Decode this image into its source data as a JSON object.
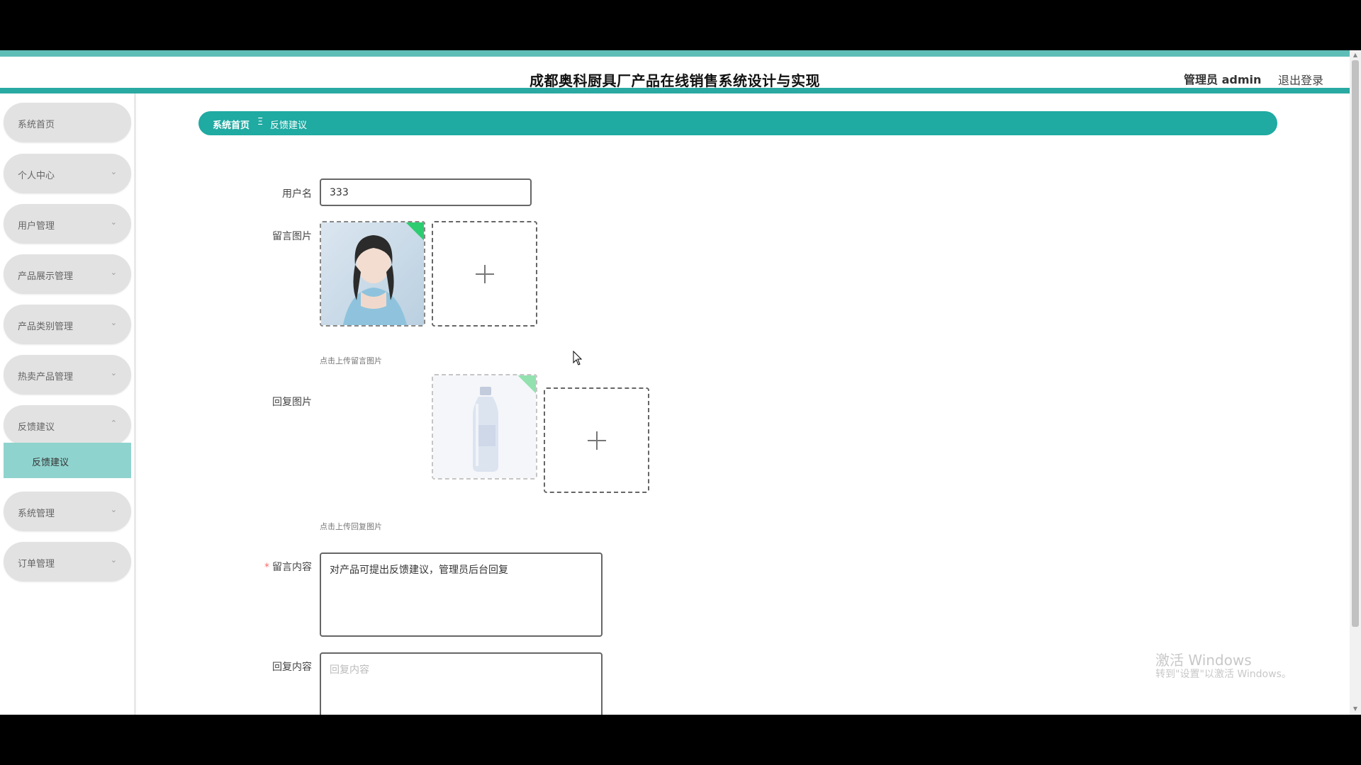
{
  "header": {
    "title": "成都奥科厨具厂产品在线销售系统设计与实现",
    "admin": "管理员 admin",
    "logout": "退出登录"
  },
  "sidebar": {
    "items": [
      {
        "label": "系统首页",
        "chevron": ""
      },
      {
        "label": "个人中心",
        "chevron": "⌄"
      },
      {
        "label": "用户管理",
        "chevron": "⌄"
      },
      {
        "label": "产品展示管理",
        "chevron": "⌄"
      },
      {
        "label": "产品类别管理",
        "chevron": "⌄"
      },
      {
        "label": "热卖产品管理",
        "chevron": "⌄"
      },
      {
        "label": "反馈建议",
        "chevron": "⌃"
      },
      {
        "label": "系统管理",
        "chevron": "⌄"
      },
      {
        "label": "订单管理",
        "chevron": "⌄"
      }
    ],
    "sub_active": "反馈建议"
  },
  "breadcrumb": {
    "home": "系统首页",
    "sep": "Ξ",
    "current": "反馈建议"
  },
  "form": {
    "username_label": "用户名",
    "username_value": "333",
    "msg_image_label": "留言图片",
    "msg_image_hint": "点击上传留言图片",
    "reply_image_label": "回复图片",
    "reply_image_hint": "点击上传回复图片",
    "required_mark": "*",
    "msg_content_label": "留言内容",
    "msg_content_value": "对产品可提出反馈建议，管理员后台回复",
    "reply_content_label": "回复内容",
    "reply_content_placeholder": "回复内容"
  },
  "watermark": {
    "line1": "激活 Windows",
    "line2": "转到\"设置\"以激活 Windows。"
  },
  "colors": {
    "accent": "#1faaa2",
    "header_band": "#2aa9a2",
    "menu_bg": "#e2e2e2",
    "submenu_active": "#8fd3ce",
    "badge": "#2ecc71"
  }
}
